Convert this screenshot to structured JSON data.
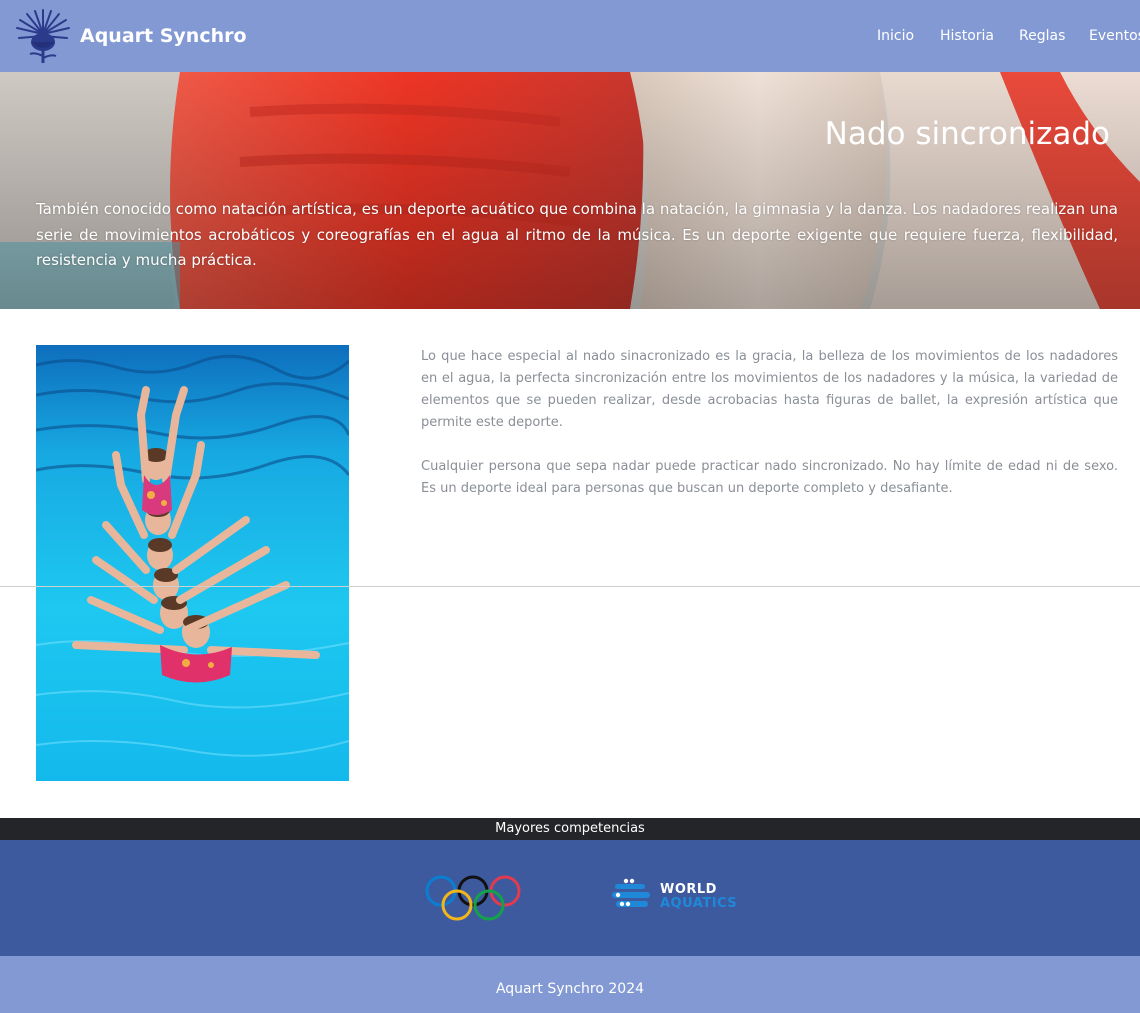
{
  "navbar": {
    "brand_name": "Aquart Synchro",
    "logo_icon": "thistle-flower-logo-icon",
    "links": [
      "Inicio",
      "Historia",
      "Reglas",
      "Eventos"
    ]
  },
  "hero": {
    "title": "Nado sincronizado",
    "text": "También conocido como natación artística, es un deporte acuático que combina la natación, la gimnasia y la danza. Los nadadores realizan una serie de movimientos acrobáticos y coreografías en el agua al ritmo de la música. Es un deporte exigente que requiere fuerza, flexibilidad, resistencia y mucha práctica."
  },
  "content": {
    "paragraphs": [
      "Lo que hace especial al nado sinacronizado es la gracia, la belleza de los movimientos de los nadadores en el agua, la perfecta sincronización entre los movimientos de los nadadores y la música, la variedad de elementos que se pueden realizar, desde acrobacias hasta figuras de ballet, la expresión artística que permite este deporte.",
      "Cualquier persona que sepa nadar puede practicar nado sincronizado. No hay límite de edad ni de sexo. Es un deporte ideal para personas que buscan un deporte completo y desafiante."
    ]
  },
  "competitions": {
    "heading": "Mayores competencias",
    "logos": [
      {
        "name": "olympic-rings-logo"
      },
      {
        "line1": "WORLD",
        "line2": "AQUATICS"
      }
    ]
  },
  "footer": {
    "text": "Aquart Synchro 2024"
  },
  "colors": {
    "navbar": "#8399d4",
    "competitions_panel": "#3d5a9e",
    "competitions_bar": "#232528",
    "footer": "#8399d4"
  }
}
